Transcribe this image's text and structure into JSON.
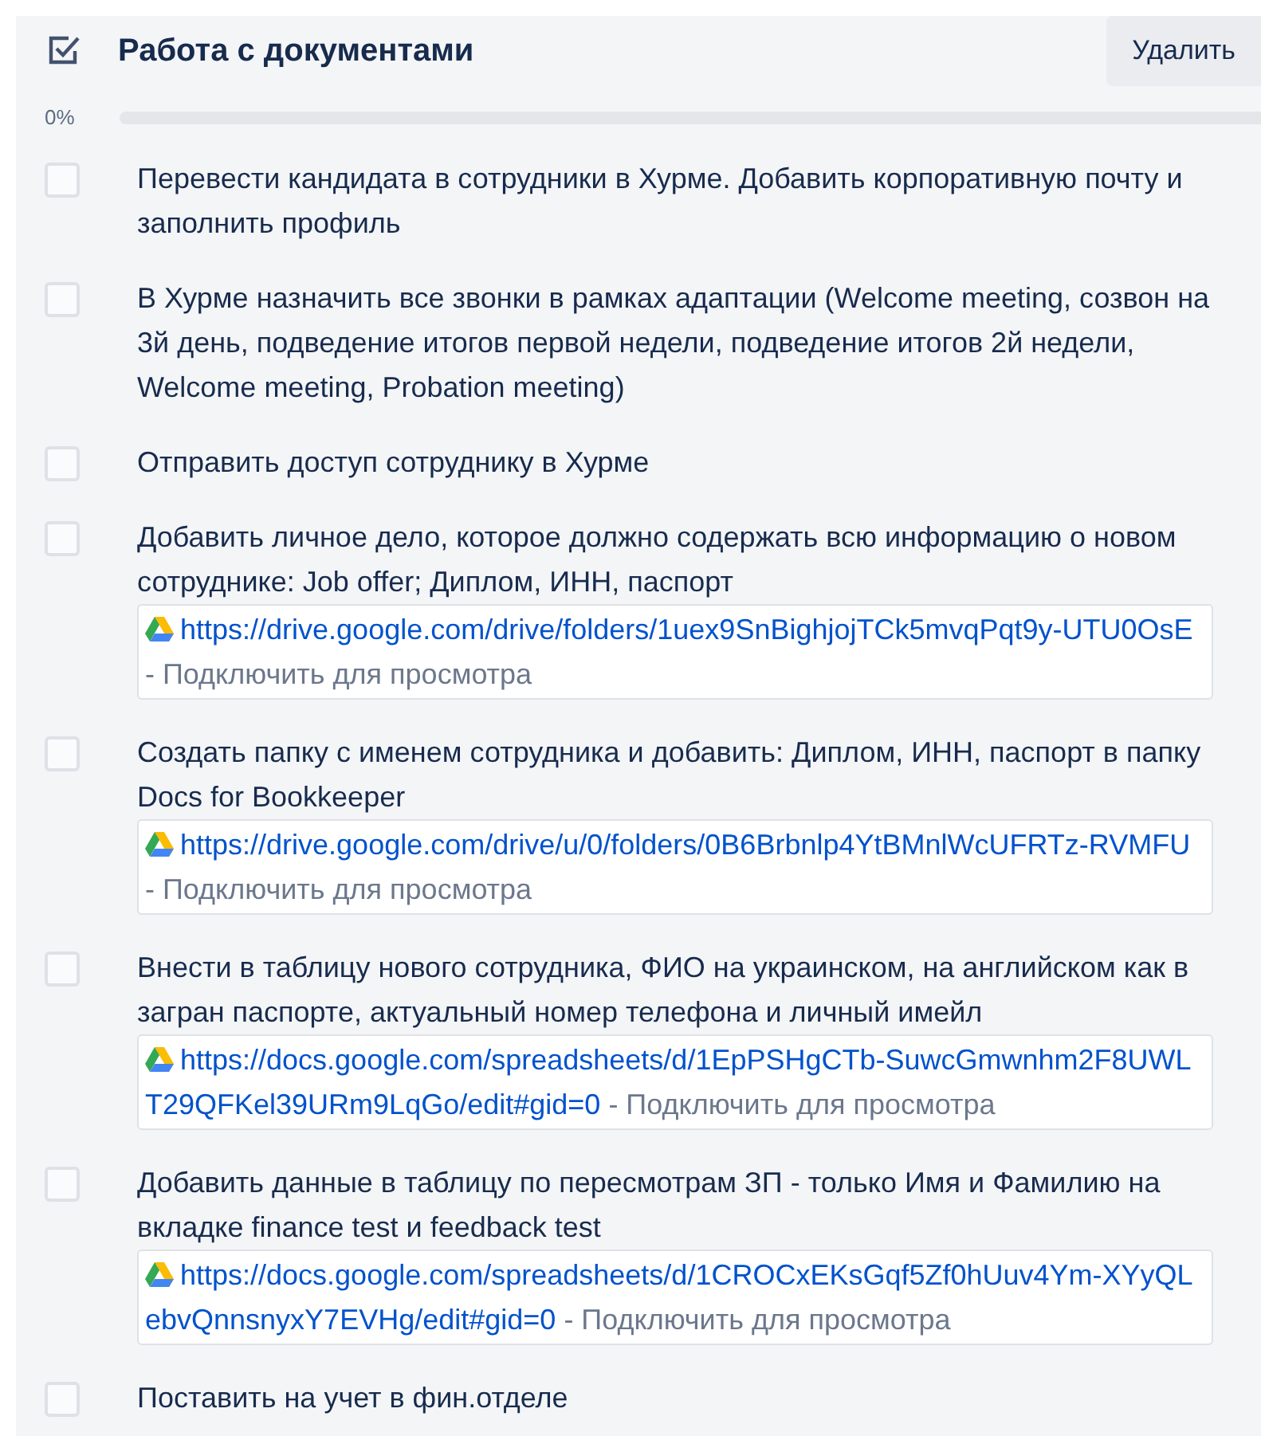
{
  "checklist": {
    "title": "Работа с документами",
    "delete_button": "Удалить",
    "progress": {
      "reading": "0%",
      "level": 0
    },
    "items": [
      {
        "text": "Перевести кандидата в сотрудники в Хурме. Добавить корпоративную почту и заполнить профиль",
        "checked": false
      },
      {
        "text": "В Хурме назначить все звонки в рамках адаптации (Welcome meeting, созвон на 3й день, подведение итогов первой недели, подведение итогов 2й недели, Welcome meeting, Probation meeting)",
        "checked": false
      },
      {
        "text": "Отправить доступ сотруднику в Хурме",
        "checked": false
      },
      {
        "text": "Добавить личное дело, которое должно содержать всю информацию о новом сотруднике: Job offer; Диплом, ИНН, паспорт",
        "checked": false,
        "link": {
          "url": "https://drive.google.com/drive/folders/1uex9SnBighjojTCk5mvqPqt9y-UTU0OsE",
          "action": "- Подключить для просмотра"
        }
      },
      {
        "text": "Создать папку с именем сотрудника и добавить: Диплом, ИНН, паспорт в папку Docs for Bookkeeper",
        "checked": false,
        "link": {
          "url": "https://drive.google.com/drive/u/0/folders/0B6Brbnlp4YtBMnlWcUFRTz-RVMFU",
          "action": "- Подключить для просмотра"
        }
      },
      {
        "text": "Внести в таблицу нового сотрудника, ФИО на украинском, на английском как в загран паспорте, актуальный номер телефона и личный имейл",
        "checked": false,
        "link": {
          "url": "https://docs.google.com/spreadsheets/d/1EpPSHgCTb-SuwcGmwnhm2F8UWLT29QFKel39URm9LqGo/edit#gid=0",
          "action": "- Подключить для просмотра"
        }
      },
      {
        "text": "Добавить данные в таблицу по пересмотрам ЗП - только Имя и Фамилию на вкладке finance test и feedback test",
        "checked": false,
        "link": {
          "url": "https://docs.google.com/spreadsheets/d/1CROCxEKsGqf5Zf0hUuv4Ym-XYyQLebvQnnsnyxY7EVHg/edit#gid=0",
          "action": "- Подключить для просмотра"
        }
      },
      {
        "text": "Поставить на учет в фин.отделе",
        "checked": false
      }
    ]
  }
}
